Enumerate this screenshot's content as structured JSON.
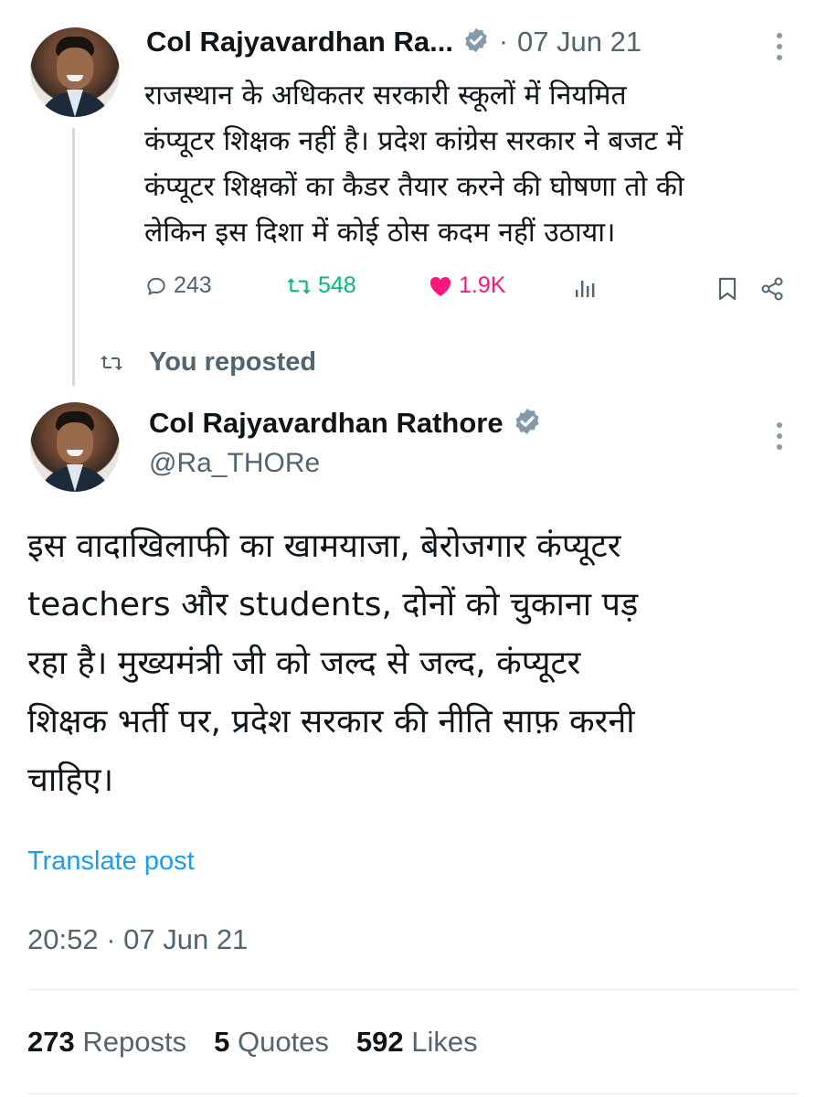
{
  "tweet1": {
    "author_name": "Col Rajyavardhan Ra...",
    "separator": "·",
    "date": "07 Jun 21",
    "text_lines": [
      "राजस्थान के अधिकतर सरकारी स्कूलों में नियमित",
      "कंप्यूटर शिक्षक नहीं है। प्रदेश कांग्रेस सरकार ने बजट में",
      "कंप्यूटर शिक्षकों का कैडर तैयार करने की घोषणा तो की",
      "लेकिन इस दिशा में कोई ठोस कदम नहीं उठाया।"
    ],
    "actions": {
      "replies": "243",
      "reposts": "548",
      "likes": "1.9K"
    },
    "colors": {
      "repost": "#00ba7c",
      "like": "#f91880",
      "verified": "#829aab"
    }
  },
  "repost_banner": {
    "label": "You reposted"
  },
  "tweet2": {
    "author_name": "Col Rajyavardhan Rathore",
    "handle": "@Ra_THORe",
    "text_lines": [
      "इस वादाखिलाफी का खामयाजा, बेरोजगार कंप्यूटर",
      "teachers और students, दोनों को चुकाना पड़",
      "रहा है। मुख्यमंत्री जी को जल्द से जल्द, कंप्यूटर",
      "शिक्षक भर्ती पर, प्रदेश सरकार की नीति साफ़ करनी",
      "चाहिए।"
    ],
    "translate_label": "Translate post",
    "timestamp": "20:52 · 07 Jun 21",
    "stats": {
      "reposts_count": "273",
      "reposts_label": "Reposts",
      "quotes_count": "5",
      "quotes_label": "Quotes",
      "likes_count": "592",
      "likes_label": "Likes"
    }
  },
  "colors": {
    "link": "#1d9bf0",
    "muted": "#536471"
  }
}
